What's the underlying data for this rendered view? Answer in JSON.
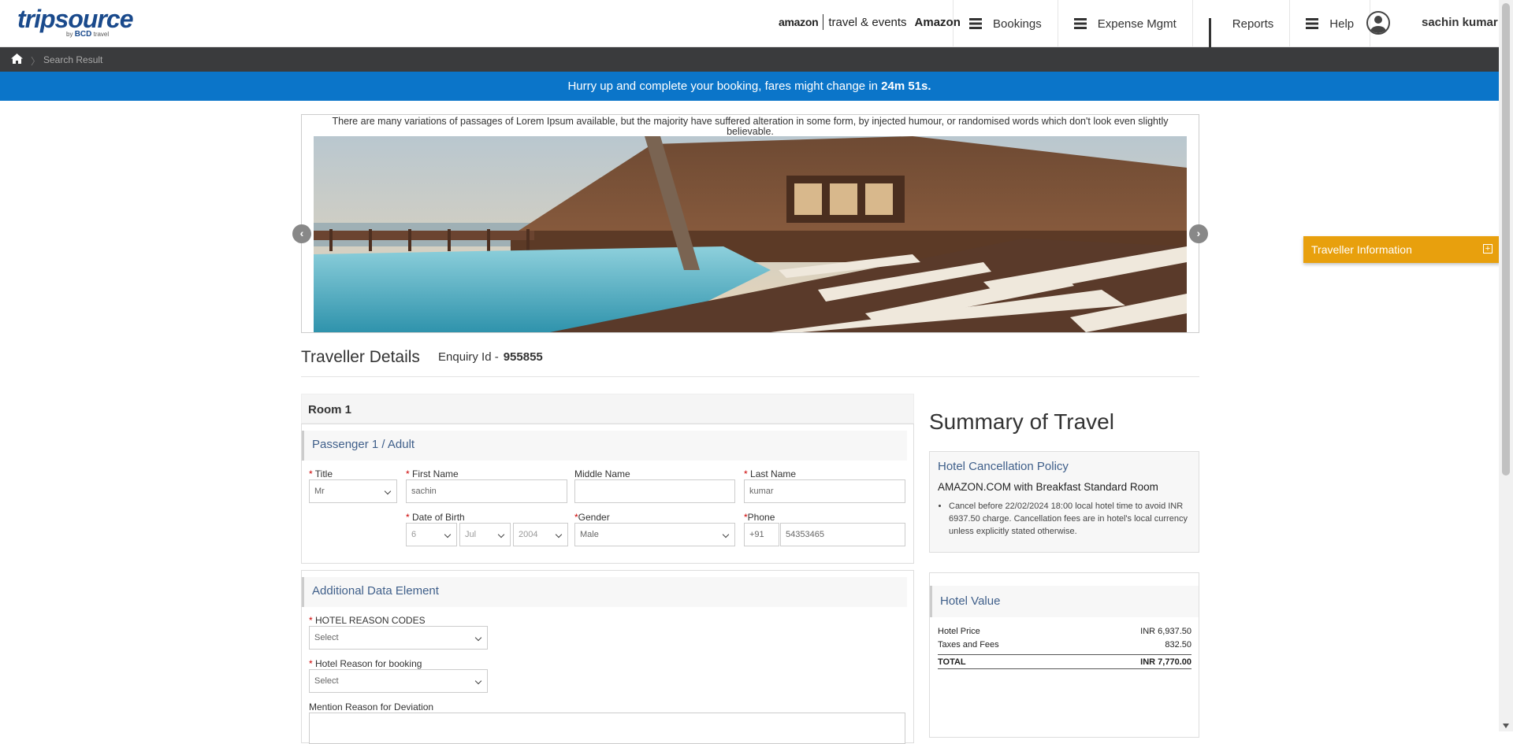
{
  "header": {
    "logo_main": "tripsource",
    "logo_sub_by": "by",
    "logo_sub_bcd": "BCD",
    "logo_sub_travel": "travel",
    "brand_amazon": "amazon",
    "brand_te": "travel & events",
    "brand_company": "Amazon",
    "nav": [
      {
        "label": "Bookings",
        "icon": "menu-icon"
      },
      {
        "label": "Expense Mgmt",
        "icon": "menu-icon"
      },
      {
        "label": "Reports",
        "icon": "bar-chart-icon"
      },
      {
        "label": "Help",
        "icon": "menu-icon"
      }
    ],
    "username": "sachin kumar"
  },
  "breadcrumb": {
    "current": "Search Result"
  },
  "alert": {
    "prefix": "Hurry up and complete your booking, fares might change in ",
    "time": "24m 51s."
  },
  "carousel": {
    "caption": "There are many variations of passages of Lorem Ipsum available, but the majority have suffered alteration in some form, by injected humour, or randomised words which don't look even slightly believable.",
    "prev": "‹",
    "next": "›"
  },
  "traveller_info": {
    "label": "Traveller Information",
    "toggle": "+"
  },
  "traveller": {
    "title": "Traveller Details",
    "enquiry_label": "Enquiry Id -",
    "enquiry_id": "955855"
  },
  "room": {
    "label": "Room 1",
    "passenger_header": "Passenger 1 / Adult",
    "fields": {
      "title_label": "Title",
      "title_value": "Mr",
      "first_name_label": "First Name",
      "first_name_value": "sachin",
      "middle_name_label": "Middle Name",
      "middle_name_value": "",
      "last_name_label": "Last Name",
      "last_name_value": "kumar",
      "dob_label": "Date of Birth",
      "dob_day": "6",
      "dob_month": "Jul",
      "dob_year": "2004",
      "gender_label": "Gender",
      "gender_value": "Male",
      "phone_label": "Phone",
      "phone_code": "+91",
      "phone_value": "54353465"
    }
  },
  "additional": {
    "header": "Additional Data Element",
    "reason_codes_label": "HOTEL REASON CODES",
    "reason_codes_value": "Select",
    "reason_booking_label": "Hotel Reason for booking",
    "reason_booking_value": "Select",
    "deviation_label": "Mention Reason for Deviation"
  },
  "summary": {
    "title": "Summary of Travel",
    "cancel_header": "Hotel Cancellation Policy",
    "room_name": "AMAZON.COM with Breakfast Standard Room",
    "policy": "Cancel before 22/02/2024 18:00 local hotel time to avoid INR 6937.50 charge. Cancellation fees are in hotel's local currency unless explicitly stated otherwise.",
    "value_header": "Hotel Value",
    "rows": [
      {
        "label": "Hotel Price",
        "value": "INR 6,937.50"
      },
      {
        "label": "Taxes and Fees",
        "value": "832.50"
      }
    ],
    "total_label": "TOTAL",
    "total_value": "INR 7,770.00"
  }
}
